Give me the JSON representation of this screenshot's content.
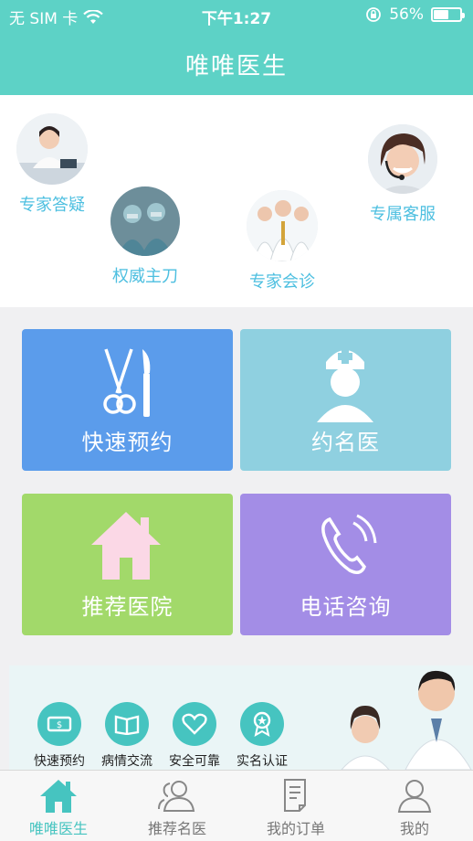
{
  "status": {
    "carrier": "无 SIM 卡",
    "time": "下午1:27",
    "battery": "56%",
    "battery_level": 0.56
  },
  "header": {
    "title": "唯唯医生"
  },
  "services": [
    {
      "label": "专家答疑"
    },
    {
      "label": "权威主刀"
    },
    {
      "label": "专家会诊"
    },
    {
      "label": "专属客服"
    }
  ],
  "tiles": [
    {
      "label": "快速预约",
      "color": "#5b9ceb"
    },
    {
      "label": "约名医",
      "color": "#8fd0e0"
    },
    {
      "label": "推荐医院",
      "color": "#a2d96a"
    },
    {
      "label": "电话咨询",
      "color": "#a38de6"
    }
  ],
  "banner": {
    "features": [
      {
        "label": "快速预约"
      },
      {
        "label": "病情交流"
      },
      {
        "label": "安全可靠"
      },
      {
        "label": "实名认证"
      }
    ]
  },
  "tabbar": {
    "items": [
      {
        "label": "唯唯医生"
      },
      {
        "label": "推荐名医"
      },
      {
        "label": "我的订单"
      },
      {
        "label": "我的"
      }
    ]
  },
  "colors": {
    "accent": "#5dd2c6",
    "service_text": "#4dbfe0"
  }
}
